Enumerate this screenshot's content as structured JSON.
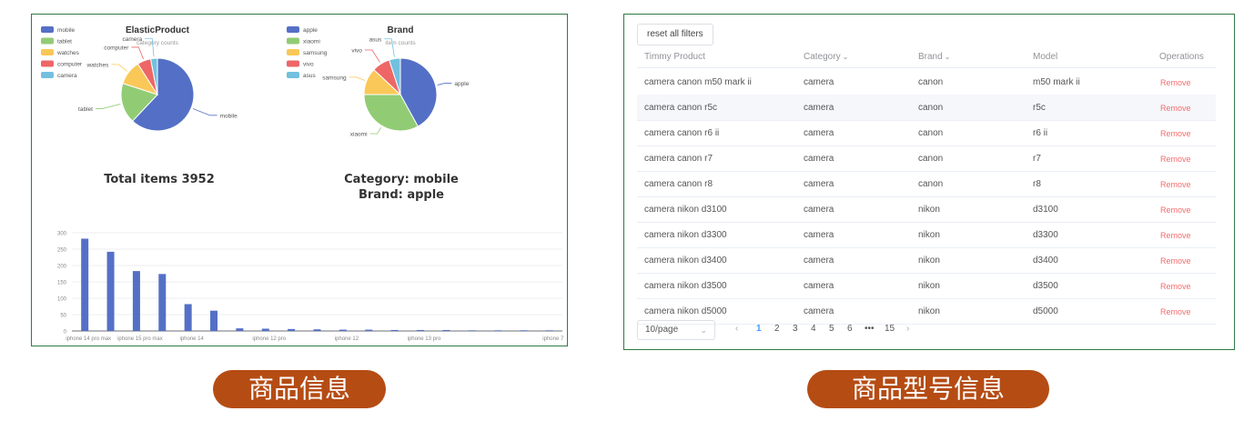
{
  "left": {
    "category_chart": {
      "title": "ElasticProduct",
      "subtitle": "category counts",
      "legend": [
        "mobile",
        "tablet",
        "watches",
        "computer",
        "camera"
      ]
    },
    "brand_chart": {
      "title": "Brand",
      "subtitle": "item counts",
      "legend": [
        "apple",
        "xiaomi",
        "samsung",
        "vivo",
        "asus"
      ]
    },
    "total_label": "Total items 3952",
    "selection_category": "Category: mobile",
    "selection_brand": "Brand: apple",
    "colors": [
      "#5470c6",
      "#91cc75",
      "#fac858",
      "#ee6666",
      "#73c0de"
    ]
  },
  "chart_data": [
    {
      "type": "pie",
      "title": "ElasticProduct",
      "subtitle": "category counts",
      "labels": [
        "mobile",
        "tablet",
        "watches",
        "computer",
        "camera"
      ],
      "values": [
        62,
        18,
        11,
        6,
        3
      ]
    },
    {
      "type": "pie",
      "title": "Brand",
      "subtitle": "item counts",
      "labels": [
        "apple",
        "xiaomi",
        "samsung",
        "vivo",
        "asus"
      ],
      "values": [
        42,
        33,
        12,
        8,
        5
      ]
    },
    {
      "type": "bar",
      "categories": [
        "iphone 14 pro max",
        "",
        "iphone 15 pro max",
        "",
        "iphone 14",
        "",
        "",
        "iphone 12 pro",
        "",
        "",
        "iphone 12",
        "",
        "",
        "iphone 13 pro",
        "",
        "",
        "",
        "",
        "iphone 7"
      ],
      "values": [
        282,
        242,
        183,
        174,
        82,
        62,
        8,
        7,
        6,
        5,
        4,
        4,
        3,
        3,
        3,
        2,
        2,
        2,
        2
      ],
      "ylim": [
        0,
        300
      ],
      "yticks": [
        "0",
        "50",
        "100",
        "150",
        "200",
        "250",
        "300"
      ]
    }
  ],
  "table": {
    "reset_label": "reset all filters",
    "headers": [
      "Timmy Product",
      "Category",
      "Brand",
      "Model",
      "Operations"
    ],
    "rows": [
      {
        "product": "camera canon m50 mark ii",
        "category": "camera",
        "brand": "canon",
        "model": "m50 mark ii",
        "op": "Remove"
      },
      {
        "product": "camera canon r5c",
        "category": "camera",
        "brand": "canon",
        "model": "r5c",
        "op": "Remove"
      },
      {
        "product": "camera canon r6 ii",
        "category": "camera",
        "brand": "canon",
        "model": "r6 ii",
        "op": "Remove"
      },
      {
        "product": "camera canon r7",
        "category": "camera",
        "brand": "canon",
        "model": "r7",
        "op": "Remove"
      },
      {
        "product": "camera canon r8",
        "category": "camera",
        "brand": "canon",
        "model": "r8",
        "op": "Remove"
      },
      {
        "product": "camera nikon d3100",
        "category": "camera",
        "brand": "nikon",
        "model": "d3100",
        "op": "Remove"
      },
      {
        "product": "camera nikon d3300",
        "category": "camera",
        "brand": "nikon",
        "model": "d3300",
        "op": "Remove"
      },
      {
        "product": "camera nikon d3400",
        "category": "camera",
        "brand": "nikon",
        "model": "d3400",
        "op": "Remove"
      },
      {
        "product": "camera nikon d3500",
        "category": "camera",
        "brand": "nikon",
        "model": "d3500",
        "op": "Remove"
      },
      {
        "product": "camera nikon d5000",
        "category": "camera",
        "brand": "nikon",
        "model": "d5000",
        "op": "Remove"
      }
    ],
    "pagination": {
      "page_size": "10/page",
      "pages": [
        "1",
        "2",
        "3",
        "4",
        "5",
        "6",
        "•••",
        "15"
      ],
      "current": "1",
      "prev": "‹",
      "next": "›"
    }
  },
  "captions": {
    "left": "商品信息",
    "right": "商品型号信息"
  },
  "colors": {
    "panel_border": "#2f7a44",
    "caption_bg": "#b54c14",
    "link_remove": "#f56c6c",
    "active_page": "#409eff"
  }
}
